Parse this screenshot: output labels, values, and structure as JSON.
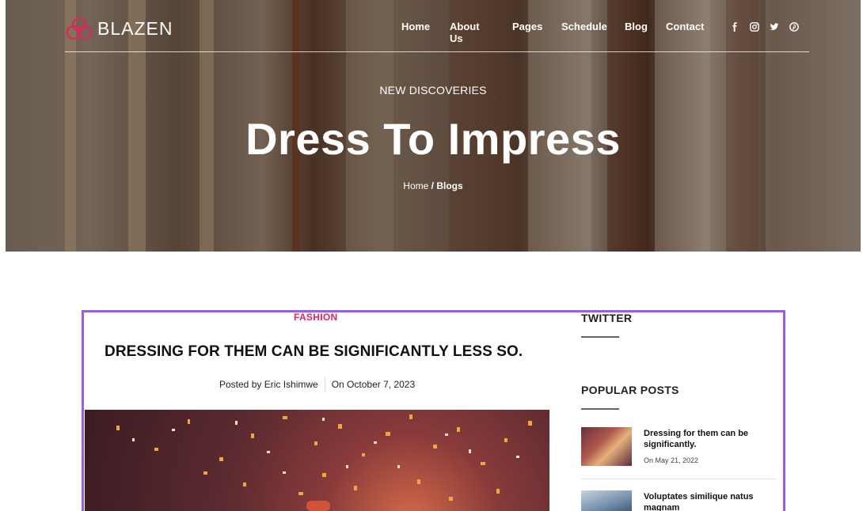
{
  "brand": {
    "name": "BLAZEN",
    "accent": "#e0245e"
  },
  "nav": {
    "items": [
      "Home",
      "About Us",
      "Pages",
      "Schedule",
      "Blog",
      "Contact"
    ]
  },
  "social": [
    "facebook-icon",
    "instagram-icon",
    "twitter-icon",
    "pinterest-icon"
  ],
  "hero": {
    "kicker": "NEW DISCOVERIES",
    "title": "Dress To Impress",
    "breadcrumb": {
      "home": "Home",
      "separator": "/",
      "current": "Blogs"
    }
  },
  "post": {
    "category": "FASHION",
    "title": "DRESSING FOR THEM CAN BE SIGNIFICANTLY LESS SO.",
    "author": "Posted by Eric Ishimwe",
    "date": "On October 7, 2023"
  },
  "sidebar": {
    "twitter_heading": "TWITTER",
    "popular_heading": "POPULAR POSTS",
    "popular_posts": [
      {
        "title": "Dressing for them can be significantly.",
        "date": "On May 21, 2022"
      },
      {
        "title": "Voluptates similique natus magnam",
        "date": ""
      }
    ]
  },
  "highlight_color": "#9b5de5"
}
